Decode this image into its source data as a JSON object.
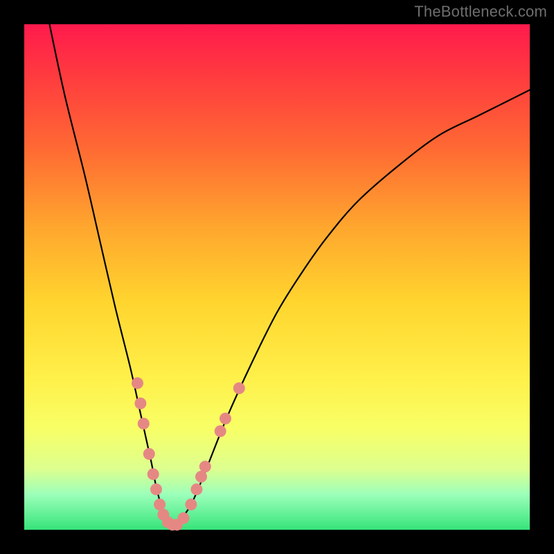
{
  "watermark": "TheBottleneck.com",
  "background": {
    "gradient_stops": [
      "#ff1a4d",
      "#ff3a3f",
      "#ff6b33",
      "#ffa62e",
      "#ffd52e",
      "#fff04a",
      "#f8ff66",
      "#ddff8f",
      "#9cffba",
      "#36e47a"
    ]
  },
  "chart_data": {
    "type": "line",
    "title": "",
    "xlabel": "",
    "ylabel": "",
    "xlim": [
      0,
      100
    ],
    "ylim": [
      0,
      100
    ],
    "series": [
      {
        "name": "bottleneck-curve",
        "x": [
          5,
          8,
          12,
          15,
          18,
          21,
          23,
          25,
          26,
          27,
          28,
          29,
          30,
          33,
          36,
          40,
          45,
          50,
          55,
          60,
          66,
          74,
          82,
          90,
          100
        ],
        "y": [
          100,
          86,
          70,
          57,
          44,
          32,
          23,
          14,
          9,
          5,
          2,
          1,
          1,
          5,
          12,
          22,
          33,
          43,
          51,
          58,
          65,
          72,
          78,
          82,
          87
        ]
      }
    ],
    "scatter_points": {
      "name": "highlighted-samples",
      "points": [
        {
          "x": 22.4,
          "y": 29
        },
        {
          "x": 23.0,
          "y": 25
        },
        {
          "x": 23.6,
          "y": 21
        },
        {
          "x": 24.7,
          "y": 15
        },
        {
          "x": 25.5,
          "y": 11
        },
        {
          "x": 26.1,
          "y": 8
        },
        {
          "x": 26.8,
          "y": 5
        },
        {
          "x": 27.5,
          "y": 3
        },
        {
          "x": 28.4,
          "y": 1.5
        },
        {
          "x": 29.3,
          "y": 1
        },
        {
          "x": 30.2,
          "y": 1
        },
        {
          "x": 31.5,
          "y": 2.3
        },
        {
          "x": 33.0,
          "y": 5
        },
        {
          "x": 34.1,
          "y": 8
        },
        {
          "x": 35.0,
          "y": 10.5
        },
        {
          "x": 35.8,
          "y": 12.5
        },
        {
          "x": 38.8,
          "y": 19.5
        },
        {
          "x": 39.8,
          "y": 22
        },
        {
          "x": 42.5,
          "y": 28
        }
      ]
    }
  }
}
